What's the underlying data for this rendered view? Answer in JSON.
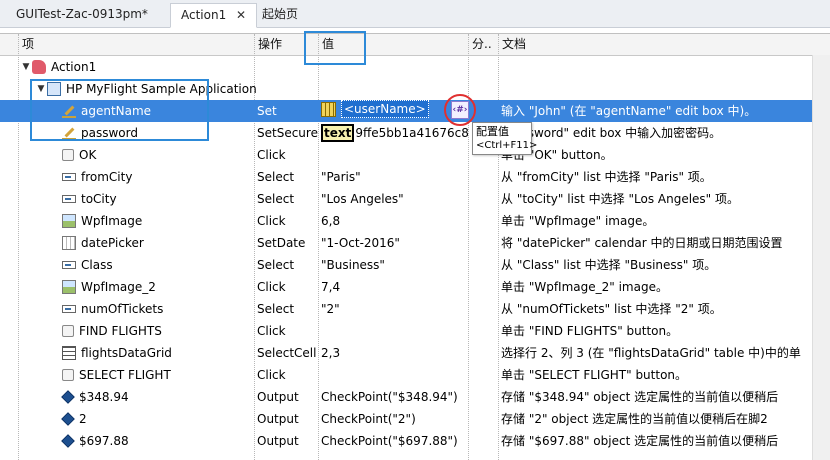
{
  "tabs": [
    {
      "label": "GUITest-Zac-0913pm*",
      "active": false
    },
    {
      "label": "Action1",
      "active": true,
      "close": "✕"
    },
    {
      "label": "起始页",
      "active": false
    }
  ],
  "columns": {
    "item": "项",
    "operation": "操作",
    "value": "值",
    "comment": "分..",
    "documentation": "文档"
  },
  "tooltip": {
    "title": "配置值",
    "shortcut": "<Ctrl+F11>"
  },
  "rows": [
    {
      "name": "Action1",
      "icon": "action-icon",
      "expand": "▼",
      "op": "",
      "value": "",
      "doc": ""
    },
    {
      "name": "HP MyFlight Sample Application",
      "icon": "application-window-icon",
      "expand": "▼",
      "op": "",
      "value": "",
      "doc": ""
    },
    {
      "name": "agentName",
      "icon": "edit-box-icon",
      "op": "Set",
      "value": "<userName>",
      "doc": "输入 \"John\" (在 \"agentName\" edit box 中)。",
      "selected": true
    },
    {
      "name": "password",
      "icon": "edit-box-icon",
      "op": "SetSecure",
      "value_badge": "text",
      "value": "9ffe5bb1a41676c8e",
      "doc": "\"password\" edit box 中输入加密密码。"
    },
    {
      "name": "OK",
      "icon": "button-icon",
      "op": "Click",
      "value": "",
      "doc": "单击 \"OK\" button。"
    },
    {
      "name": "fromCity",
      "icon": "list-icon",
      "op": "Select",
      "value": "\"Paris\"",
      "doc": "从 \"fromCity\" list 中选择 \"Paris\" 项。"
    },
    {
      "name": "toCity",
      "icon": "list-icon",
      "op": "Select",
      "value": "\"Los Angeles\"",
      "doc": "从 \"toCity\" list 中选择 \"Los Angeles\" 项。"
    },
    {
      "name": "WpfImage",
      "icon": "image-icon",
      "op": "Click",
      "value": "6,8",
      "doc": "单击 \"WpfImage\" image。"
    },
    {
      "name": "datePicker",
      "icon": "calendar-icon",
      "op": "SetDate",
      "value": "\"1-Oct-2016\"",
      "doc": "将 \"datePicker\" calendar 中的日期或日期范围设置"
    },
    {
      "name": "Class",
      "icon": "list-icon",
      "op": "Select",
      "value": "\"Business\"",
      "doc": "从 \"Class\" list 中选择 \"Business\" 项。"
    },
    {
      "name": "WpfImage_2",
      "icon": "image-icon",
      "op": "Click",
      "value": "7,4",
      "doc": "单击 \"WpfImage_2\" image。"
    },
    {
      "name": "numOfTickets",
      "icon": "list-icon",
      "op": "Select",
      "value": "\"2\"",
      "doc": "从 \"numOfTickets\" list 中选择 \"2\" 项。"
    },
    {
      "name": "FIND FLIGHTS",
      "icon": "button-icon",
      "op": "Click",
      "value": "",
      "doc": "单击 \"FIND FLIGHTS\" button。"
    },
    {
      "name": "flightsDataGrid",
      "icon": "table-icon",
      "op": "SelectCell",
      "value": "2,3",
      "doc": "选择行 2、列 3 (在 \"flightsDataGrid\" table 中)中的单"
    },
    {
      "name": "SELECT FLIGHT",
      "icon": "button-icon",
      "op": "Click",
      "value": "",
      "doc": "单击 \"SELECT FLIGHT\" button。"
    },
    {
      "name": "$348.94",
      "icon": "checkpoint-icon",
      "op": "Output",
      "value": "CheckPoint(\"$348.94\")",
      "doc": "存储 \"$348.94\" object 选定属性的当前值以便稍后"
    },
    {
      "name": "2",
      "icon": "checkpoint-icon",
      "op": "Output",
      "value": "CheckPoint(\"2\")",
      "doc": "存储 \"2\" object 选定属性的当前值以便稍后在脚2"
    },
    {
      "name": "$697.88",
      "icon": "checkpoint-icon",
      "op": "Output",
      "value": "CheckPoint(\"$697.88\")",
      "doc": "存储 \"$697.88\" object 选定属性的当前值以便稍后"
    }
  ],
  "colors": {
    "selection": "#3a85dd",
    "annotation_box": "#2d8ad8",
    "annotation_circle": "#e03030"
  }
}
